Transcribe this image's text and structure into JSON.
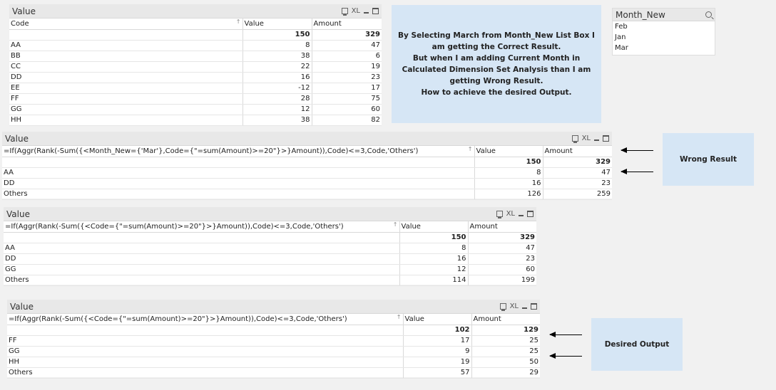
{
  "table1": {
    "title": "Value",
    "xl": "XL",
    "headers": [
      "Code",
      "Value",
      "Amount"
    ],
    "totals": [
      "",
      "150",
      "329"
    ],
    "rows": [
      [
        "AA",
        "8",
        "47"
      ],
      [
        "BB",
        "38",
        "6"
      ],
      [
        "CC",
        "22",
        "19"
      ],
      [
        "DD",
        "16",
        "23"
      ],
      [
        "EE",
        "-12",
        "17"
      ],
      [
        "FF",
        "28",
        "75"
      ],
      [
        "GG",
        "12",
        "60"
      ],
      [
        "HH",
        "38",
        "82"
      ]
    ]
  },
  "note_top": {
    "lines": [
      "By Selecting March from Month_New List Box I",
      "am getting the Correct Result.",
      "But when I am adding Current Month in",
      "Calculated Dimension Set Analysis than I am",
      "getting Wrong Result.",
      "How to achieve the desired Output."
    ]
  },
  "listbox": {
    "title": "Month_New",
    "items": [
      "Feb",
      "Jan",
      "Mar"
    ]
  },
  "table2": {
    "title": "Value",
    "xl": "XL",
    "headers": [
      "=If(Aggr(Rank(-Sum({<Month_New={'Mar'},Code={\"=sum(Amount)>=20\"}>}Amount)),Code)<=3,Code,'Others')",
      "Value",
      "Amount"
    ],
    "totals": [
      "",
      "150",
      "329"
    ],
    "rows": [
      [
        "AA",
        "8",
        "47"
      ],
      [
        "DD",
        "16",
        "23"
      ],
      [
        "Others",
        "126",
        "259"
      ]
    ]
  },
  "wrong_result": {
    "label": "Wrong Result"
  },
  "table3": {
    "title": "Value",
    "xl": "XL",
    "headers": [
      "=If(Aggr(Rank(-Sum({<Code={\"=sum(Amount)>=20\"}>}Amount)),Code)<=3,Code,'Others')",
      "Value",
      "Amount"
    ],
    "totals": [
      "",
      "150",
      "329"
    ],
    "rows": [
      [
        "AA",
        "8",
        "47"
      ],
      [
        "DD",
        "16",
        "23"
      ],
      [
        "GG",
        "12",
        "60"
      ],
      [
        "Others",
        "114",
        "199"
      ]
    ]
  },
  "table4": {
    "title": "Value",
    "xl": "XL",
    "headers": [
      "=If(Aggr(Rank(-Sum({<Code={\"=sum(Amount)>=20\"}>}Amount)),Code)<=3,Code,'Others')",
      "Value",
      "Amount"
    ],
    "totals": [
      "",
      "102",
      "129"
    ],
    "rows": [
      [
        "FF",
        "17",
        "25"
      ],
      [
        "GG",
        "9",
        "25"
      ],
      [
        "HH",
        "19",
        "50"
      ],
      [
        "Others",
        "57",
        "29"
      ]
    ]
  },
  "desired_output": {
    "label": "Desired Output"
  },
  "colors": {
    "note_bg": "#d6e6f5",
    "caption_bg": "#e8e8e8",
    "page_bg": "#f1f1f1"
  }
}
